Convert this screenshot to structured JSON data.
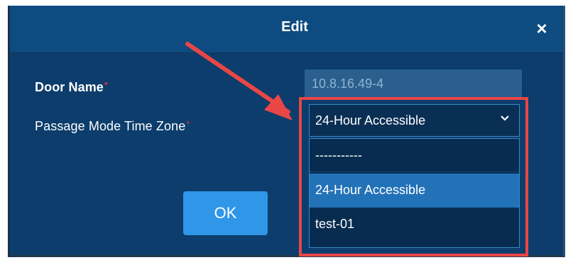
{
  "dialog": {
    "title": "Edit",
    "close_icon": "close-icon",
    "close_symbol": "×"
  },
  "form": {
    "door_name": {
      "label": "Door Name",
      "required_marker": "*",
      "value": "10.8.16.49-4"
    },
    "passage_mode": {
      "label": "Passage Mode Time Zone",
      "required_marker": "*",
      "selected": "24-Hour Accessible",
      "options": [
        "-----------",
        "24-Hour Accessible",
        "test-01"
      ]
    }
  },
  "buttons": {
    "ok_label": "OK"
  },
  "colors": {
    "dialog_bg": "#0c3d6c",
    "header_bg": "#0e4b80",
    "accent": "#2f96e8",
    "highlight_red": "#e94646",
    "selected_option": "#2272b8",
    "required": "#e03a3a"
  },
  "icons": {
    "chevron": "chevron-down-icon",
    "arrow": "annotation-arrow-icon"
  }
}
